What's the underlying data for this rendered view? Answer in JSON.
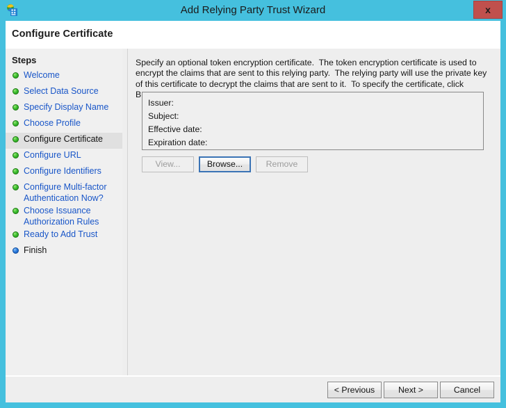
{
  "window": {
    "title": "Add Relying Party Trust Wizard",
    "icon": "adfs-server-globe-icon",
    "close_label": "x",
    "accent_color": "#45c0de"
  },
  "header": {
    "title": "Configure Certificate"
  },
  "sidebar": {
    "heading": "Steps",
    "items": [
      {
        "label": "Welcome",
        "state": "done",
        "bullet": "green-bullet-icon"
      },
      {
        "label": "Select Data Source",
        "state": "done",
        "bullet": "green-bullet-icon"
      },
      {
        "label": "Specify Display Name",
        "state": "done",
        "bullet": "green-bullet-icon"
      },
      {
        "label": "Choose Profile",
        "state": "done",
        "bullet": "green-bullet-icon"
      },
      {
        "label": "Configure Certificate",
        "state": "active",
        "bullet": "green-bullet-icon"
      },
      {
        "label": "Configure URL",
        "state": "done",
        "bullet": "green-bullet-icon"
      },
      {
        "label": "Configure Identifiers",
        "state": "done",
        "bullet": "green-bullet-icon"
      },
      {
        "label": "Configure Multi-factor Authentication Now?",
        "state": "done",
        "bullet": "green-bullet-icon"
      },
      {
        "label": "Choose Issuance Authorization Rules",
        "state": "done",
        "bullet": "green-bullet-icon"
      },
      {
        "label": "Ready to Add Trust",
        "state": "done",
        "bullet": "green-bullet-icon"
      },
      {
        "label": "Finish",
        "state": "pending",
        "bullet": "blue-bullet-icon"
      }
    ]
  },
  "main": {
    "description": "Specify an optional token encryption certificate.  The token encryption certificate is used to encrypt the claims that are sent to this relying party.  The relying party will use the private key of this certificate to decrypt the claims that are sent to it.  To specify the certificate, click Browse..",
    "certificate": {
      "issuer_label": "Issuer:",
      "issuer_value": "",
      "subject_label": "Subject:",
      "subject_value": "",
      "effective_label": "Effective date:",
      "effective_value": "",
      "expiration_label": "Expiration date:",
      "expiration_value": ""
    },
    "buttons": {
      "view": "View...",
      "browse": "Browse...",
      "remove": "Remove"
    }
  },
  "footer": {
    "previous": "< Previous",
    "next": "Next >",
    "cancel": "Cancel"
  }
}
